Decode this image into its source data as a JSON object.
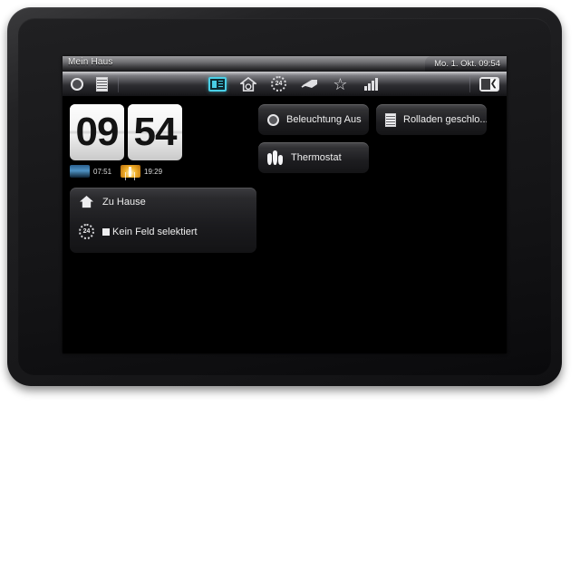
{
  "device": {
    "nav_keys": [
      {
        "name": "menu",
        "glyph": "square"
      },
      {
        "name": "home",
        "glyph": "circle"
      },
      {
        "name": "back",
        "glyph": "triangle-left"
      }
    ]
  },
  "titlebar": {
    "title": "Mein Haus",
    "datetime": "Mo. 1. Okt. 09:54"
  },
  "toolbar": {
    "left_icons": [
      {
        "name": "lighting-icon",
        "label": "Beleuchtung"
      },
      {
        "name": "blinds-icon",
        "label": "Rolladen"
      }
    ],
    "center_icons": [
      {
        "name": "dashboard-icon",
        "label": "Übersicht",
        "active": true,
        "color": "#49cfe6"
      },
      {
        "name": "home-camera-icon",
        "label": "Haus"
      },
      {
        "name": "timer-24h-icon",
        "label": "24",
        "badge": "24"
      },
      {
        "name": "camera-icon",
        "label": "Kamera"
      },
      {
        "name": "favorites-star-icon",
        "label": "Favoriten",
        "glyph": "☆"
      },
      {
        "name": "signal-bars-icon",
        "label": "Status"
      }
    ],
    "right_icons": [
      {
        "name": "collapse-panel-icon",
        "label": "Einklappen",
        "glyph": "❮"
      }
    ]
  },
  "clock": {
    "hours": "09",
    "minutes": "54",
    "sunrise_time": "07:51",
    "sunset_time": "19:29"
  },
  "actions": [
    {
      "id": "lighting",
      "label": "Beleuchtung Aus",
      "icon": "bulb-icon"
    },
    {
      "id": "blinds",
      "label": "Rolladen geschlo...",
      "icon": "blinds-icon"
    },
    {
      "id": "thermostat",
      "label": "Thermostat",
      "icon": "thermometer-icon"
    }
  ],
  "info_panel": {
    "location_label": "Zu Hause",
    "location_icon": "home-icon",
    "field_label": "Kein Feld selektiert",
    "field_icon": "timer-24h-icon",
    "field_checkbox_checked": true
  },
  "colors": {
    "accent": "#49cfe6",
    "screen_bg": "#000000",
    "bezel": "#1a1a1c",
    "page_bg": "#ffffff"
  }
}
